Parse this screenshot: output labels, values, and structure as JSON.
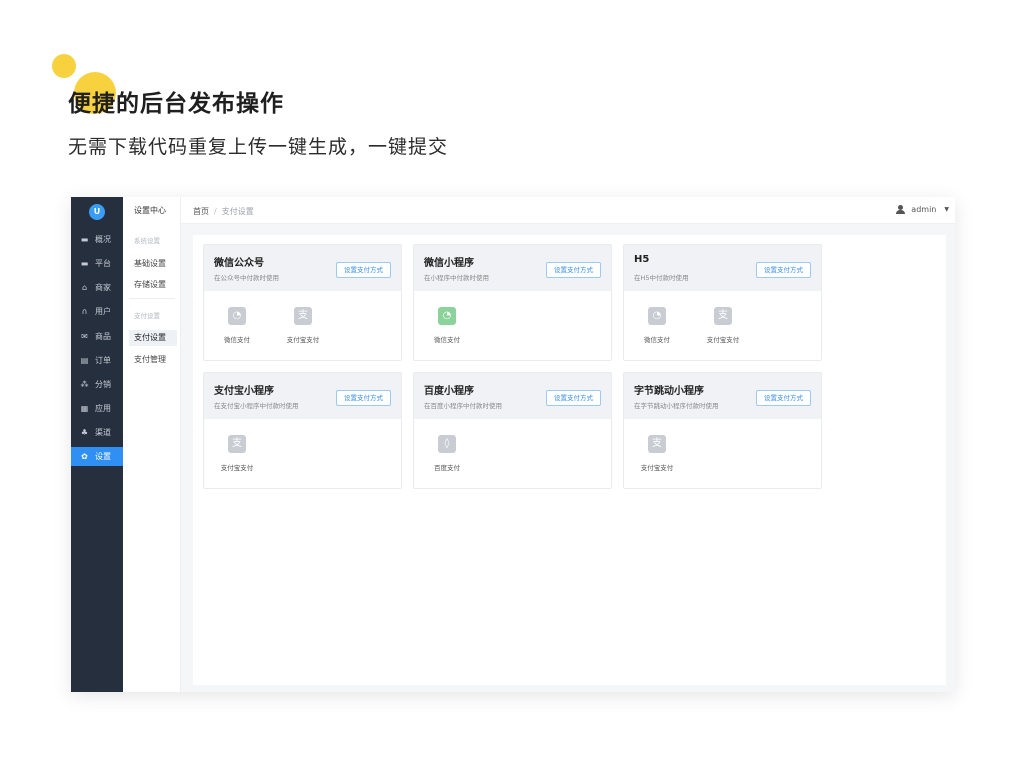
{
  "hero": {
    "title": "便捷的后台发布操作",
    "subtitle": "无需下载代码重复上传一键生成，一键提交"
  },
  "sidebar": {
    "logo": "U",
    "items": [
      {
        "label": "概况",
        "icon": "monitor-icon"
      },
      {
        "label": "平台",
        "icon": "desktop-icon"
      },
      {
        "label": "商家",
        "icon": "store-icon"
      },
      {
        "label": "用户",
        "icon": "headset-icon"
      },
      {
        "label": "商品",
        "icon": "mail-icon"
      },
      {
        "label": "订单",
        "icon": "clipboard-icon"
      },
      {
        "label": "分销",
        "icon": "network-icon"
      },
      {
        "label": "应用",
        "icon": "grid-icon"
      },
      {
        "label": "渠道",
        "icon": "cluster-icon"
      },
      {
        "label": "设置",
        "icon": "gear-icon",
        "active": true
      }
    ]
  },
  "subnav": {
    "title": "设置中心",
    "group1": "系统设置",
    "item1": "基础设置",
    "item2": "存储设置",
    "group2": "支付设置",
    "item3": "支付设置",
    "item4": "支付管理"
  },
  "topbar": {
    "crumb_home": "首页",
    "crumb_sep": "/",
    "crumb_current": "支付设置",
    "user": "admin",
    "caret": "▼"
  },
  "cards": [
    {
      "title": "微信公众号",
      "desc": "在公众号中付款时使用",
      "button": "设置支付方式",
      "pays": [
        {
          "label": "微信支付",
          "icon": "wechat-pay-icon"
        },
        {
          "label": "支付宝支付",
          "icon": "alipay-icon"
        }
      ]
    },
    {
      "title": "微信小程序",
      "desc": "在小程序中付款时使用",
      "button": "设置支付方式",
      "pays": [
        {
          "label": "微信支付",
          "icon": "wechat-pay-icon-green"
        }
      ]
    },
    {
      "title": "H5",
      "desc": "在H5中付款时使用",
      "button": "设置支付方式",
      "pays": [
        {
          "label": "微信支付",
          "icon": "wechat-pay-icon"
        },
        {
          "label": "支付宝支付",
          "icon": "alipay-icon"
        }
      ]
    },
    {
      "title": "支付宝小程序",
      "desc": "在支付宝小程序中付款时使用",
      "button": "设置支付方式",
      "pays": [
        {
          "label": "支付宝支付",
          "icon": "alipay-icon"
        }
      ]
    },
    {
      "title": "百度小程序",
      "desc": "在百度小程序中付款时使用",
      "button": "设置支付方式",
      "pays": [
        {
          "label": "百度支付",
          "icon": "baidu-pay-icon"
        }
      ]
    },
    {
      "title": "字节跳动小程序",
      "desc": "在字节跳动小程序付款时使用",
      "button": "设置支付方式",
      "pays": [
        {
          "label": "支付宝支付",
          "icon": "alipay-icon"
        }
      ]
    }
  ]
}
